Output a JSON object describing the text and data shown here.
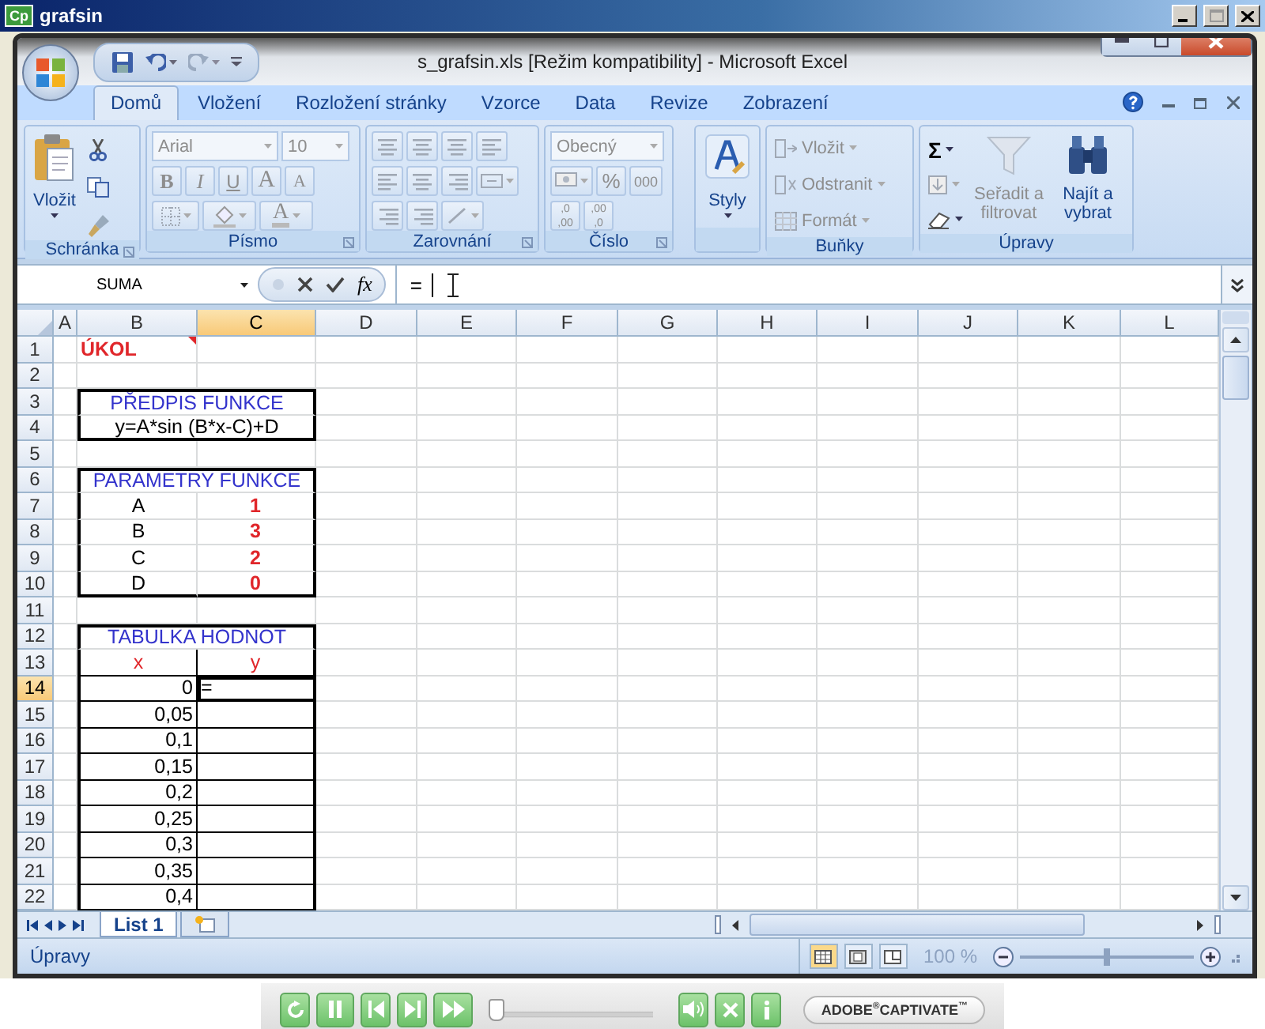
{
  "app": {
    "icon": "Cp",
    "title": "grafsin"
  },
  "window": {
    "title": "s_grafsin.xls  [Režim kompatibility] - Microsoft Excel"
  },
  "tabs": [
    {
      "label": "Domů",
      "selected": true
    },
    {
      "label": "Vložení",
      "selected": false
    },
    {
      "label": "Rozložení stránky",
      "selected": false
    },
    {
      "label": "Vzorce",
      "selected": false
    },
    {
      "label": "Data",
      "selected": false
    },
    {
      "label": "Revize",
      "selected": false
    },
    {
      "label": "Zobrazení",
      "selected": false
    }
  ],
  "ribbon": {
    "clipboard": {
      "label": "Schránka",
      "paste": "Vložit"
    },
    "font": {
      "label": "Písmo",
      "font_name": "Arial",
      "font_size": "10",
      "disabled": true,
      "color_label": "A",
      "buttons": [
        {
          "label": "B",
          "kind": "bold"
        },
        {
          "label": "I",
          "kind": "italic"
        },
        {
          "label": "U",
          "kind": "underline"
        },
        {
          "label": "A",
          "kind": "grow"
        },
        {
          "label": "A",
          "kind": "shrink"
        }
      ]
    },
    "alignment": {
      "label": "Zarovnání",
      "disabled": true
    },
    "number": {
      "label": "Číslo",
      "format": "Obecný",
      "percent": "%",
      "thousands": "000",
      "disabled": true,
      "decimals": [
        {
          "lines": [
            ",0",
            ",00"
          ]
        },
        {
          "lines": [
            ",00",
            ",0"
          ]
        }
      ]
    },
    "styles": {
      "label": "Styly"
    },
    "cells": {
      "label": "Buňky",
      "items": [
        {
          "label": "Vložit",
          "disabled": true
        },
        {
          "label": "Odstranit",
          "disabled": true
        },
        {
          "label": "Formát",
          "disabled": true
        }
      ]
    },
    "editing": {
      "label": "Úpravy",
      "sum": "Σ",
      "items": [
        {
          "label": "Seřadit a filtrovat",
          "disabled": true
        },
        {
          "label": "Najít a vybrat",
          "disabled": false
        }
      ]
    }
  },
  "formula_bar": {
    "name_box": "SUMA",
    "fx": "fx",
    "formula": "="
  },
  "sheet": {
    "columns": [
      {
        "label": "A",
        "selected": false
      },
      {
        "label": "B",
        "selected": false
      },
      {
        "label": "C",
        "selected": true
      },
      {
        "label": "D",
        "selected": false
      },
      {
        "label": "E",
        "selected": false
      },
      {
        "label": "F",
        "selected": false
      },
      {
        "label": "G",
        "selected": false
      },
      {
        "label": "H",
        "selected": false
      },
      {
        "label": "I",
        "selected": false
      },
      {
        "label": "J",
        "selected": false
      },
      {
        "label": "K",
        "selected": false
      },
      {
        "label": "L",
        "selected": false
      }
    ],
    "rows": [
      {
        "label": "1",
        "selected": false,
        "boxed": false,
        "box_top": false,
        "box_bottom": false,
        "B": {
          "text": "ÚKOL",
          "kind": "task",
          "comment": true
        }
      },
      {
        "label": "2",
        "selected": false,
        "boxed": false,
        "box_top": false,
        "box_bottom": false
      },
      {
        "label": "3",
        "selected": false,
        "boxed": true,
        "box_top": true,
        "box_bottom": false,
        "B": {
          "text": "PŘEDPIS FUNKCE",
          "kind": "title",
          "merged": true
        }
      },
      {
        "label": "4",
        "selected": false,
        "boxed": true,
        "box_top": false,
        "box_bottom": true,
        "B": {
          "text": "y=A*sin (B*x-C)+D",
          "kind": "formula",
          "merged": true
        }
      },
      {
        "label": "5",
        "selected": false,
        "boxed": false,
        "box_top": false,
        "box_bottom": false
      },
      {
        "label": "6",
        "selected": false,
        "boxed": true,
        "box_top": true,
        "box_bottom": false,
        "B": {
          "text": "PARAMETRY FUNKCE",
          "kind": "title",
          "merged": true
        }
      },
      {
        "label": "7",
        "selected": false,
        "boxed": true,
        "box_top": false,
        "box_bottom": false,
        "B": {
          "text": "A",
          "kind": "param"
        },
        "C": {
          "text": "1",
          "kind": "value"
        }
      },
      {
        "label": "8",
        "selected": false,
        "boxed": true,
        "box_top": false,
        "box_bottom": false,
        "B": {
          "text": "B",
          "kind": "param"
        },
        "C": {
          "text": "3",
          "kind": "value"
        }
      },
      {
        "label": "9",
        "selected": false,
        "boxed": true,
        "box_top": false,
        "box_bottom": false,
        "B": {
          "text": "C",
          "kind": "param"
        },
        "C": {
          "text": "2",
          "kind": "value"
        }
      },
      {
        "label": "10",
        "selected": false,
        "boxed": true,
        "box_top": false,
        "box_bottom": true,
        "B": {
          "text": "D",
          "kind": "param"
        },
        "C": {
          "text": "0",
          "kind": "value"
        }
      },
      {
        "label": "11",
        "selected": false,
        "boxed": false,
        "box_top": false,
        "box_bottom": false
      },
      {
        "label": "12",
        "selected": false,
        "boxed": true,
        "box_top": true,
        "box_bottom": false,
        "B": {
          "text": "TABULKA HODNOT",
          "kind": "title",
          "merged": true
        }
      },
      {
        "label": "13",
        "selected": false,
        "boxed": true,
        "box_top": false,
        "box_bottom": false,
        "B": {
          "text": "x",
          "kind": "header"
        },
        "C": {
          "text": "y",
          "kind": "header"
        }
      },
      {
        "label": "14",
        "selected": true,
        "boxed": true,
        "box_top": false,
        "box_bottom": false,
        "B": {
          "text": "0",
          "kind": "number"
        },
        "editor": {
          "text": "=",
          "active": true
        }
      },
      {
        "label": "15",
        "selected": false,
        "boxed": true,
        "box_top": false,
        "box_bottom": false,
        "B": {
          "text": "0,05",
          "kind": "number"
        },
        "C": {
          "kind": "number"
        }
      },
      {
        "label": "16",
        "selected": false,
        "boxed": true,
        "box_top": false,
        "box_bottom": false,
        "B": {
          "text": "0,1",
          "kind": "number"
        },
        "C": {
          "kind": "number"
        }
      },
      {
        "label": "17",
        "selected": false,
        "boxed": true,
        "box_top": false,
        "box_bottom": false,
        "B": {
          "text": "0,15",
          "kind": "number"
        },
        "C": {
          "kind": "number"
        }
      },
      {
        "label": "18",
        "selected": false,
        "boxed": true,
        "box_top": false,
        "box_bottom": false,
        "B": {
          "text": "0,2",
          "kind": "number"
        },
        "C": {
          "kind": "number"
        }
      },
      {
        "label": "19",
        "selected": false,
        "boxed": true,
        "box_top": false,
        "box_bottom": false,
        "B": {
          "text": "0,25",
          "kind": "number"
        },
        "C": {
          "kind": "number"
        }
      },
      {
        "label": "20",
        "selected": false,
        "boxed": true,
        "box_top": false,
        "box_bottom": false,
        "B": {
          "text": "0,3",
          "kind": "number"
        },
        "C": {
          "kind": "number"
        }
      },
      {
        "label": "21",
        "selected": false,
        "boxed": true,
        "box_top": false,
        "box_bottom": false,
        "B": {
          "text": "0,35",
          "kind": "number"
        },
        "C": {
          "kind": "number"
        }
      },
      {
        "label": "22",
        "selected": false,
        "boxed": true,
        "box_top": false,
        "box_bottom": false,
        "B": {
          "text": "0,4",
          "kind": "number"
        },
        "C": {
          "kind": "number"
        }
      }
    ]
  },
  "sheet_tabs": [
    {
      "label": "List 1",
      "selected": true
    }
  ],
  "status_bar": {
    "mode": "Úpravy",
    "zoom": "100 %",
    "zoom_slider": {
      "level": 0.5
    }
  },
  "player": {
    "progress": {
      "level": 0.02
    },
    "logo": "ADOBE$^{®}$CAPTIVATE$^{™}$"
  }
}
